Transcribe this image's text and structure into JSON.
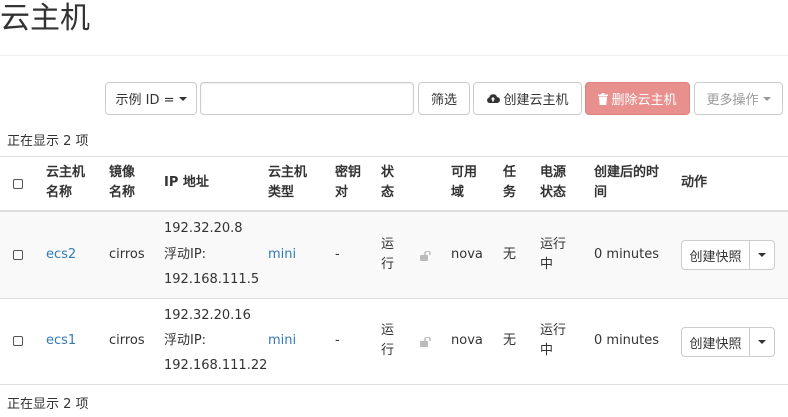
{
  "page": {
    "title": "云主机"
  },
  "toolbar": {
    "filter_field": "示例 ID =",
    "filter_value": "",
    "filter_button": "筛选",
    "create_button": "创建云主机",
    "delete_button": "删除云主机",
    "more_button": "更多操作"
  },
  "summary": {
    "top": "正在显示 2 项",
    "bottom": "正在显示 2 项"
  },
  "table": {
    "headers": {
      "name": [
        "云主机",
        "名称"
      ],
      "image": [
        "镜像",
        "名称"
      ],
      "ip": "IP 地址",
      "flavor": [
        "云主机",
        "类型"
      ],
      "keypair": [
        "密钥",
        "对"
      ],
      "status": [
        "状",
        "态"
      ],
      "az": [
        "可用",
        "域"
      ],
      "task": [
        "任",
        "务"
      ],
      "power": [
        "电源",
        "状态"
      ],
      "age": [
        "创建后的时",
        "间"
      ],
      "actions": "动作"
    },
    "rows": [
      {
        "name": "ecs2",
        "image": "cirros",
        "ip_fixed": "192.32.20.8",
        "ip_float_label": "浮动IP:",
        "ip_float": "192.168.111.5",
        "flavor": "mini",
        "keypair": "-",
        "status": [
          "运",
          "行"
        ],
        "az": "nova",
        "task": "无",
        "power": [
          "运行",
          "中"
        ],
        "age": "0 minutes",
        "action": "创建快照"
      },
      {
        "name": "ecs1",
        "image": "cirros",
        "ip_fixed": "192.32.20.16",
        "ip_float_label": "浮动IP:",
        "ip_float": "192.168.111.22",
        "flavor": "mini",
        "keypair": "-",
        "status": [
          "运",
          "行"
        ],
        "az": "nova",
        "task": "无",
        "power": [
          "运行",
          "中"
        ],
        "age": "0 minutes",
        "action": "创建快照"
      }
    ]
  },
  "colors": {
    "link": "#337ab7",
    "danger": "#e7908e",
    "row_stripe": "#f9f9f9",
    "border": "#dddddd"
  }
}
